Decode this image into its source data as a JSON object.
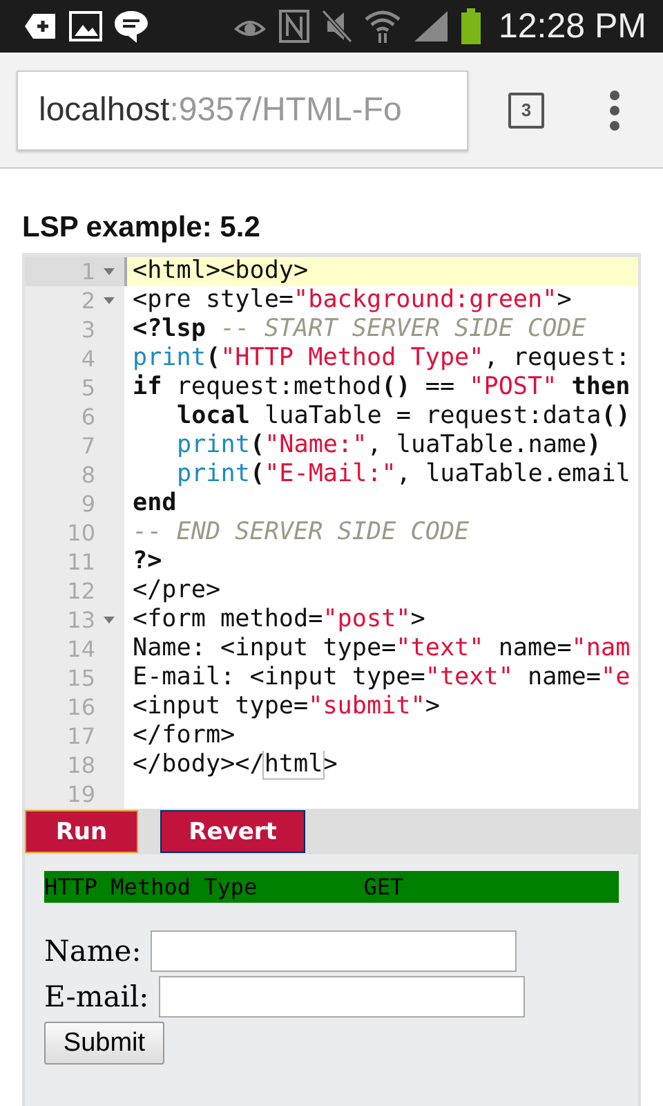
{
  "status_bar": {
    "time": "12:28 PM"
  },
  "browser": {
    "url_host": "localhost",
    "url_rest": ":9357/HTML-Fo",
    "tab_count": "3"
  },
  "heading": "LSP example: 5.2",
  "editor": {
    "lines": [
      {
        "number": "1",
        "foldable": true,
        "active": true,
        "tokens": [
          {
            "kind": "plain",
            "text": "<html><body>"
          }
        ]
      },
      {
        "number": "2",
        "foldable": true,
        "active": false,
        "tokens": [
          {
            "kind": "plain",
            "text": "<pre style="
          },
          {
            "kind": "string",
            "text": "\"background:green\""
          },
          {
            "kind": "plain",
            "text": ">"
          }
        ]
      },
      {
        "number": "3",
        "foldable": false,
        "active": false,
        "tokens": [
          {
            "kind": "keyword",
            "text": "<?lsp"
          },
          {
            "kind": "comment",
            "text": " -- START SERVER SIDE CODE"
          }
        ]
      },
      {
        "number": "4",
        "foldable": false,
        "active": false,
        "tokens": [
          {
            "kind": "builtin",
            "text": "print"
          },
          {
            "kind": "keyword",
            "text": "("
          },
          {
            "kind": "string",
            "text": "\"HTTP Method Type\""
          },
          {
            "kind": "plain",
            "text": ", request:"
          }
        ]
      },
      {
        "number": "5",
        "foldable": false,
        "active": false,
        "tokens": [
          {
            "kind": "keyword",
            "text": "if"
          },
          {
            "kind": "plain",
            "text": " request:method"
          },
          {
            "kind": "keyword",
            "text": "()"
          },
          {
            "kind": "plain",
            "text": " == "
          },
          {
            "kind": "string",
            "text": "\"POST\""
          },
          {
            "kind": "keyword",
            "text": " then"
          }
        ]
      },
      {
        "number": "6",
        "foldable": false,
        "active": false,
        "indented": true,
        "tokens": [
          {
            "kind": "keyword",
            "text": "local"
          },
          {
            "kind": "plain",
            "text": " luaTable = request:data"
          },
          {
            "kind": "keyword",
            "text": "()"
          }
        ]
      },
      {
        "number": "7",
        "foldable": false,
        "active": false,
        "indented": true,
        "tokens": [
          {
            "kind": "builtin",
            "text": "print"
          },
          {
            "kind": "keyword",
            "text": "("
          },
          {
            "kind": "string",
            "text": "\"Name:\""
          },
          {
            "kind": "plain",
            "text": ", luaTable.name"
          },
          {
            "kind": "keyword",
            "text": ")"
          }
        ]
      },
      {
        "number": "8",
        "foldable": false,
        "active": false,
        "indented": true,
        "tokens": [
          {
            "kind": "builtin",
            "text": "print"
          },
          {
            "kind": "keyword",
            "text": "("
          },
          {
            "kind": "string",
            "text": "\"E-Mail:\""
          },
          {
            "kind": "plain",
            "text": ", luaTable.email"
          }
        ]
      },
      {
        "number": "9",
        "foldable": false,
        "active": false,
        "tokens": [
          {
            "kind": "keyword",
            "text": "end"
          }
        ]
      },
      {
        "number": "10",
        "foldable": false,
        "active": false,
        "tokens": [
          {
            "kind": "comment",
            "text": "-- END SERVER SIDE CODE"
          }
        ]
      },
      {
        "number": "11",
        "foldable": false,
        "active": false,
        "tokens": [
          {
            "kind": "keyword",
            "text": "?>"
          }
        ]
      },
      {
        "number": "12",
        "foldable": false,
        "active": false,
        "tokens": [
          {
            "kind": "plain",
            "text": "</pre>"
          }
        ]
      },
      {
        "number": "13",
        "foldable": true,
        "active": false,
        "tokens": [
          {
            "kind": "plain",
            "text": "<form method="
          },
          {
            "kind": "string",
            "text": "\"post\""
          },
          {
            "kind": "plain",
            "text": ">"
          }
        ]
      },
      {
        "number": "14",
        "foldable": false,
        "active": false,
        "tokens": [
          {
            "kind": "plain",
            "text": "Name: <input type="
          },
          {
            "kind": "string",
            "text": "\"text\""
          },
          {
            "kind": "plain",
            "text": " name="
          },
          {
            "kind": "string",
            "text": "\"nam"
          }
        ]
      },
      {
        "number": "15",
        "foldable": false,
        "active": false,
        "tokens": [
          {
            "kind": "plain",
            "text": "E-mail: <input type="
          },
          {
            "kind": "string",
            "text": "\"text\""
          },
          {
            "kind": "plain",
            "text": " name="
          },
          {
            "kind": "string",
            "text": "\"e"
          }
        ]
      },
      {
        "number": "16",
        "foldable": false,
        "active": false,
        "tokens": [
          {
            "kind": "plain",
            "text": "<input type="
          },
          {
            "kind": "string",
            "text": "\"submit\""
          },
          {
            "kind": "plain",
            "text": ">"
          }
        ]
      },
      {
        "number": "17",
        "foldable": false,
        "active": false,
        "tokens": [
          {
            "kind": "plain",
            "text": "</form>"
          }
        ]
      },
      {
        "number": "18",
        "foldable": false,
        "active": false,
        "tokens": [
          {
            "kind": "plain",
            "text": "</body></"
          },
          {
            "kind": "matched",
            "text": "html"
          },
          {
            "kind": "plain",
            "text": ">"
          }
        ]
      },
      {
        "number": "19",
        "foldable": false,
        "active": false
      }
    ]
  },
  "actions": [
    {
      "label": "Run",
      "focused": true
    },
    {
      "label": "Revert",
      "focused": false
    }
  ],
  "output": {
    "pre_text": "HTTP Method Type        GET",
    "fields": [
      {
        "label": "Name:"
      },
      {
        "label": "E-mail:"
      }
    ],
    "submit": "Submit"
  }
}
